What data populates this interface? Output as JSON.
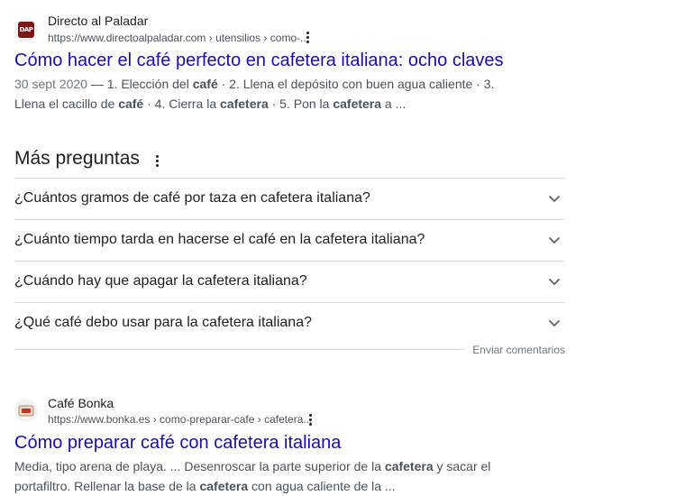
{
  "results": [
    {
      "site_name": "Directo al Paladar",
      "url": "https://www.directoalpaladar.com › utensilios › como-...",
      "favicon_label": "DAP",
      "title": "Cómo hacer el café perfecto en cafetera italiana: ocho claves",
      "date": "30 sept 2020",
      "snippet_parts": [
        {
          "t": " — 1. Elección del ",
          "b": false
        },
        {
          "t": "café",
          "b": true
        },
        {
          "t": " · 2. Llena el depósito con buen agua caliente · 3. Llena el cacillo de ",
          "b": false
        },
        {
          "t": "café",
          "b": true
        },
        {
          "t": " · 4. Cierra la ",
          "b": false
        },
        {
          "t": "cafetera",
          "b": true
        },
        {
          "t": " · 5. Pon la ",
          "b": false
        },
        {
          "t": "cafetera",
          "b": true
        },
        {
          "t": " a ...",
          "b": false
        }
      ]
    },
    {
      "site_name": "Café Bonka",
      "url": "https://www.bonka.es › como-preparar-cafe › cafetera...",
      "title": "Cómo preparar café con cafetera italiana",
      "snippet_parts": [
        {
          "t": "Media, tipo arena de playa. ... Desenroscar la parte superior de la ",
          "b": false
        },
        {
          "t": "cafetera",
          "b": true
        },
        {
          "t": " y sacar el portafiltro. Rellenar la base de la ",
          "b": false
        },
        {
          "t": "cafetera",
          "b": true
        },
        {
          "t": " con agua caliente de la ...",
          "b": false
        }
      ]
    }
  ],
  "paa": {
    "title": "Más preguntas",
    "questions": [
      "¿Cuántos gramos de café por taza en cafetera italiana?",
      "¿Cuánto tiempo tarda en hacerse el café en la cafetera italiana?",
      "¿Cuándo hay que apagar la cafetera italiana?",
      "¿Qué café debo usar para la cafetera italiana?"
    ],
    "feedback": "Enviar comentarios"
  },
  "colors": {
    "link": "#1a0dab",
    "text": "#202124",
    "snippet": "#4d5156",
    "divider": "#dadce0"
  }
}
